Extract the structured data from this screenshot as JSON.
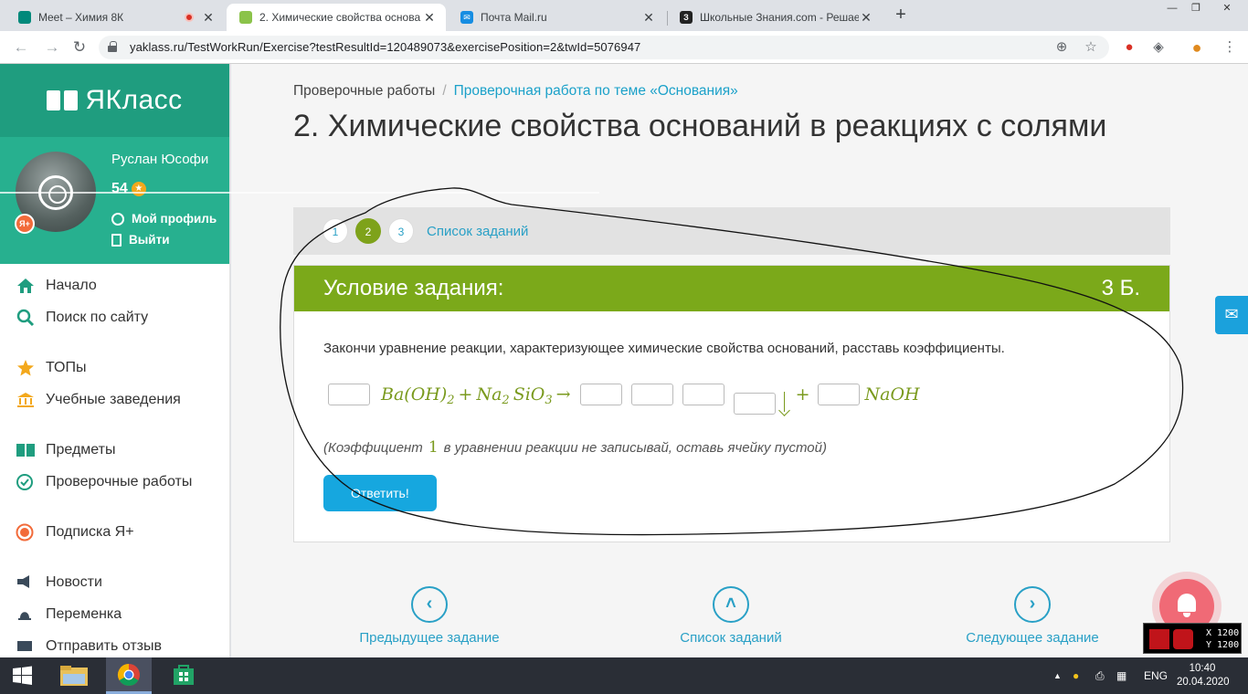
{
  "browser": {
    "tabs": [
      {
        "title": "Meet – Химия 8К",
        "favicon_color": "#00897b",
        "recording": true
      },
      {
        "title": "2. Химические свойства основа",
        "favicon_color": "#8bc34a",
        "active": true
      },
      {
        "title": "Почта Mail.ru",
        "favicon_color": "#168de2"
      },
      {
        "title": "Школьные Знания.com - Решае",
        "favicon_color": "#222222"
      }
    ],
    "url": "yaklass.ru/TestWorkRun/Exercise?testResultId=120489073&exercisePosition=2&twId=5076947",
    "window_controls": {
      "minimize": "—",
      "maximize": "❐",
      "close": "✕"
    }
  },
  "sidebar": {
    "logo": "ЯКласс",
    "user": {
      "name": "Руслан Юсофи",
      "points": "54",
      "profile_link": "Мой профиль",
      "logout_link": "Выйти",
      "badge": "Я+"
    },
    "menu": [
      {
        "label": "Начало",
        "icon": "home-icon"
      },
      {
        "label": "Поиск по сайту",
        "icon": "search-icon"
      },
      {
        "label": "ТОПы",
        "icon": "star-icon"
      },
      {
        "label": "Учебные заведения",
        "icon": "school-icon"
      },
      {
        "label": "Предметы",
        "icon": "book-icon"
      },
      {
        "label": "Проверочные работы",
        "icon": "check-icon"
      },
      {
        "label": "Подписка Я+",
        "icon": "subscription-icon"
      },
      {
        "label": "Новости",
        "icon": "news-icon"
      },
      {
        "label": "Переменка",
        "icon": "bell-icon"
      },
      {
        "label": "Отправить отзыв",
        "icon": "feedback-icon"
      }
    ]
  },
  "main": {
    "breadcrumb": {
      "root": "Проверочные работы",
      "separator": "/",
      "current": "Проверочная работа по теме «Основания»"
    },
    "title": "2. Химические свойства оснований в реакциях с солями",
    "steps": [
      "1",
      "2",
      "3"
    ],
    "current_step": "2",
    "steps_list_link": "Список заданий",
    "task": {
      "header": "Условие задания:",
      "points": "3 Б.",
      "text": "Закончи уравнение реакции, характеризующее химические свойства оснований, расставь коэффициенты.",
      "equation": {
        "reactant1": "Ba(OH)",
        "reactant1_sub": "2",
        "plus": "+",
        "reactant2_a": "Na",
        "reactant2_sub1": "2",
        "reactant2_b": "SiO",
        "reactant2_sub2": "3",
        "arrow": "→",
        "product_plus": "+",
        "product": "NaOH"
      },
      "note_before": "(Коэффициент",
      "note_one": "1",
      "note_after": "в уравнении реакции не записывай, оставь ячейку пустой)",
      "answer_button": "Ответить!"
    },
    "nav": {
      "prev": "Предыдущее задание",
      "list": "Список заданий",
      "next": "Следующее задание"
    },
    "overlay": {
      "x": "X 1200",
      "y": "Y 1200"
    }
  },
  "taskbar": {
    "lang": "ENG",
    "time": "10:40",
    "date": "20.04.2020"
  },
  "colors": {
    "brand_green": "#1f9d7f",
    "task_header": "#7ba91a",
    "link_blue": "#29a0c6",
    "button_blue": "#16a7df"
  }
}
